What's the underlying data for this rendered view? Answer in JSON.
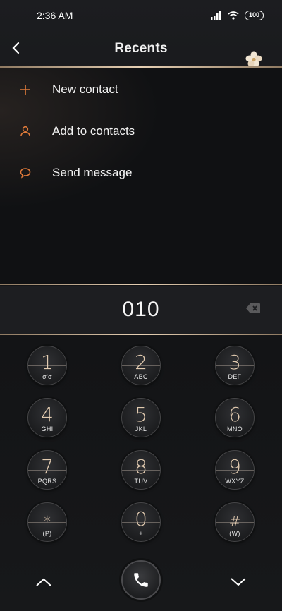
{
  "status_bar": {
    "time": "2:36 AM",
    "battery": "100"
  },
  "header": {
    "title": "Recents"
  },
  "menu": {
    "items": [
      {
        "label": "New contact",
        "icon": "plus-icon"
      },
      {
        "label": "Add to contacts",
        "icon": "person-icon"
      },
      {
        "label": "Send message",
        "icon": "chat-bubble-icon"
      }
    ]
  },
  "dialer": {
    "number": "010",
    "keys": [
      {
        "digit": "1",
        "letters": "σ'σ"
      },
      {
        "digit": "2",
        "letters": "ABC"
      },
      {
        "digit": "3",
        "letters": "DEF"
      },
      {
        "digit": "4",
        "letters": "GHI"
      },
      {
        "digit": "5",
        "letters": "JKL"
      },
      {
        "digit": "6",
        "letters": "MNO"
      },
      {
        "digit": "7",
        "letters": "PQRS"
      },
      {
        "digit": "8",
        "letters": "TUV"
      },
      {
        "digit": "9",
        "letters": "WXYZ"
      },
      {
        "digit": "*",
        "letters": "(P)"
      },
      {
        "digit": "0",
        "letters": "+"
      },
      {
        "digit": "#",
        "letters": "(W)"
      }
    ]
  },
  "colors": {
    "accent": "#e07a3a",
    "gold": "#e2cbb0"
  }
}
